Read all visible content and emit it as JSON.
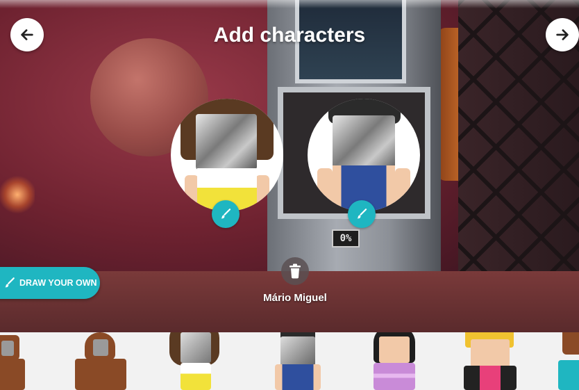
{
  "header": {
    "title": "Add characters"
  },
  "selected_characters": [
    {
      "edit_icon": "brush-icon"
    },
    {
      "edit_icon": "brush-icon"
    }
  ],
  "scene": {
    "counter_text": "0%"
  },
  "draw_button": {
    "label": "DRAW YOUR OWN",
    "icon": "brush-icon"
  },
  "active_character": {
    "name": "Mário Miguel",
    "delete_icon": "trash-icon"
  },
  "colors": {
    "accent": "#1fb6c1",
    "tray_background": "#f2f2f2"
  }
}
